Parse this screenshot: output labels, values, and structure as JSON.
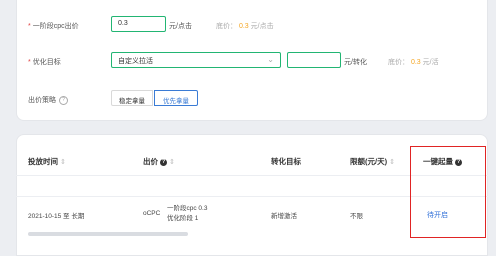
{
  "form": {
    "bid_label": "一阶段cpc出价",
    "bid_value": "0.3",
    "bid_unit": "元/点击",
    "bid_floor_label": "底价：",
    "bid_floor_value": "0.3",
    "bid_floor_unit": "元/点击",
    "goal_label": "优化目标",
    "goal_select_value": "自定义拉活",
    "goal_unit": "元/转化",
    "goal_floor_label": "底价：",
    "goal_floor_value": "0.3",
    "goal_floor_unit": "元/活",
    "strategy_label": "出价策略",
    "strategy_options": [
      "稳定拿量",
      "优先拿量"
    ],
    "strategy_selected": "优先拿量"
  },
  "table": {
    "headers": [
      "投放时间",
      "出价",
      "转化目标",
      "限额(元/天)",
      "一键起量"
    ],
    "row": {
      "time": "2021-10-15 至 长期",
      "bid_type": "oCPC",
      "bid_line1": "一阶段cpc 0.3",
      "bid_line2": "优化阶段 1",
      "goal": "新增激活",
      "limit": "不限",
      "action": "待开启"
    }
  },
  "colors": {
    "accent_green": "#22b573",
    "accent_orange": "#f5a623",
    "link_blue": "#2f6fd8",
    "highlight_red": "#e02424"
  }
}
